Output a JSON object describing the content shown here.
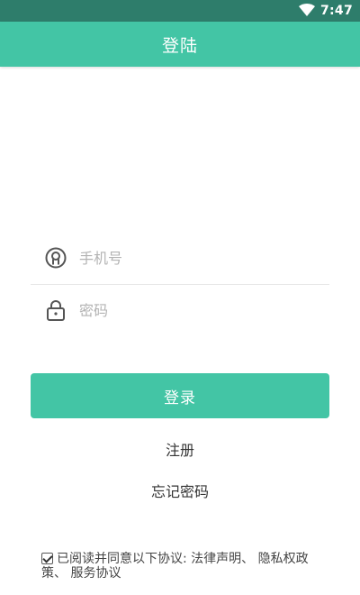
{
  "status_bar": {
    "time": "7:47",
    "wifi_icon": "wifi-icon"
  },
  "app_bar": {
    "title": "登陆"
  },
  "form": {
    "phone": {
      "placeholder": "手机号",
      "value": "",
      "icon": "user-icon"
    },
    "password": {
      "placeholder": "密码",
      "value": "",
      "icon": "lock-icon"
    }
  },
  "actions": {
    "login_label": "登录",
    "register_label": "注册",
    "forgot_label": "忘记密码"
  },
  "agreement": {
    "checked": true,
    "prefix": "已阅读并同意以下协议:",
    "legal": "法律声明",
    "sep1": "、",
    "privacy": "隐私权政策",
    "sep2": "、",
    "service": "服务协议"
  },
  "colors": {
    "primary": "#43c5a5",
    "status_bar": "#2e7d6b"
  }
}
